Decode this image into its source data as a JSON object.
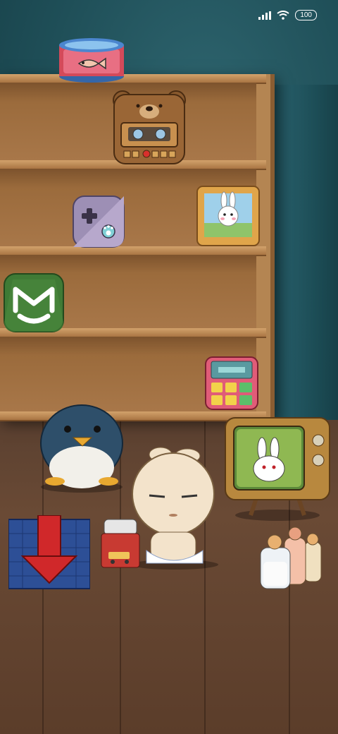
{
  "status_bar": {
    "battery": "100",
    "signal_icon": "signal-bars-icon",
    "wifi_icon": "wifi-icon"
  },
  "apps": [
    {
      "name": "fish-tank-app",
      "icon": "fish-tank-icon"
    },
    {
      "name": "bear-cassette-app",
      "icon": "bear-cassette-icon"
    },
    {
      "name": "game-controller-app",
      "icon": "game-controller-icon"
    },
    {
      "name": "bunny-photo-frame-app",
      "icon": "bunny-photo-frame-icon"
    },
    {
      "name": "mi-app",
      "icon": "mi-logo-icon"
    },
    {
      "name": "calculator-app",
      "icon": "calculator-icon"
    },
    {
      "name": "bunny-tv-app",
      "icon": "bunny-tv-icon"
    },
    {
      "name": "download-blocks-app",
      "icon": "download-arrow-blocks-icon"
    },
    {
      "name": "milk-bottles-app",
      "icon": "milk-bottles-icon"
    }
  ],
  "decor": {
    "penguin": "penguin-toy-icon",
    "bunny_baby": "bunny-baby-character-icon",
    "toy_car": "toy-car-icon"
  },
  "colors": {
    "wall": "#1f4f58",
    "shelf": "#b48552",
    "floor": "#5a4030",
    "mi_green": "#3f7a35"
  }
}
